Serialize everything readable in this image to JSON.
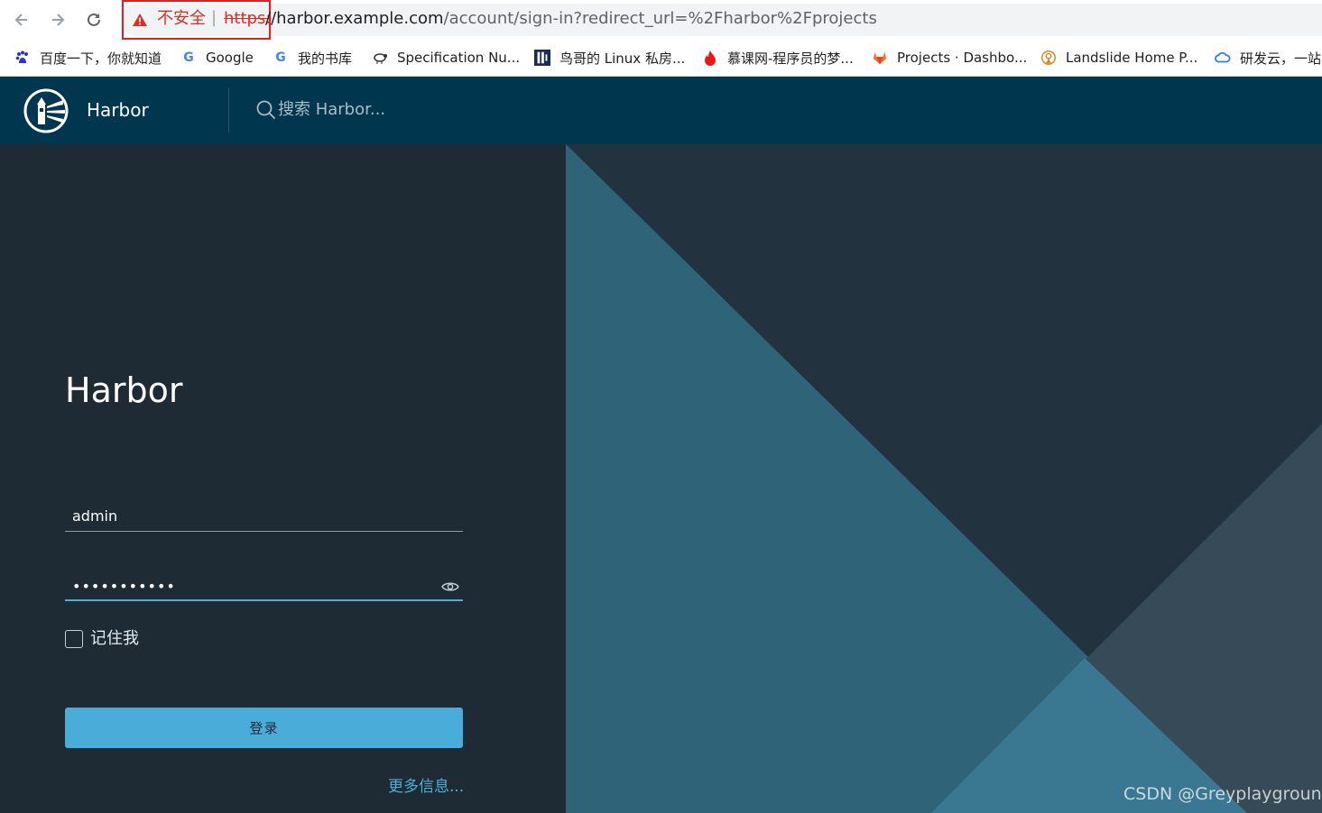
{
  "browser": {
    "security_label": "不安全",
    "separator": "|",
    "url_scheme": "https:",
    "url_host": "//harbor.example.com",
    "url_path": "/account/sign-in?redirect_url=%2Fharbor%2Fprojects",
    "bookmarks": [
      {
        "label": "百度一下，你就知道",
        "icon": "baidu-paw-icon",
        "color": "#2932e1"
      },
      {
        "label": "Google",
        "icon": "google-g-icon",
        "color": "#4285f4"
      },
      {
        "label": "我的书库",
        "icon": "google-g-icon",
        "color": "#4285f4"
      },
      {
        "label": "Specification Nu...",
        "icon": "sheep-icon",
        "color": "#333333"
      },
      {
        "label": "鸟哥的 Linux 私房...",
        "icon": "vbird-icon",
        "color": "#1a2a5a"
      },
      {
        "label": "慕课网-程序员的梦...",
        "icon": "flame-icon",
        "color": "#f01414"
      },
      {
        "label": "Projects · Dashbo...",
        "icon": "gitlab-icon",
        "color": "#fc6d26"
      },
      {
        "label": "Landslide Home P...",
        "icon": "landslide-icon",
        "color": "#e07b00"
      },
      {
        "label": "研发云，一站",
        "icon": "cloud-icon",
        "color": "#2d7cf6"
      }
    ]
  },
  "header": {
    "brand": "Harbor",
    "search_placeholder": "搜索 Harbor..."
  },
  "login": {
    "title": "Harbor",
    "username_value": "admin",
    "password_value": "•••••••••••",
    "remember_label": "记住我",
    "remember_checked": false,
    "submit_label": "登录",
    "more_info_label": "更多信息..."
  },
  "watermark": "CSDN @Greyplayground",
  "colors": {
    "header_bg": "#00364e",
    "panel_bg": "#1e2b35",
    "accent": "#49acd9",
    "warning": "#d93025"
  }
}
